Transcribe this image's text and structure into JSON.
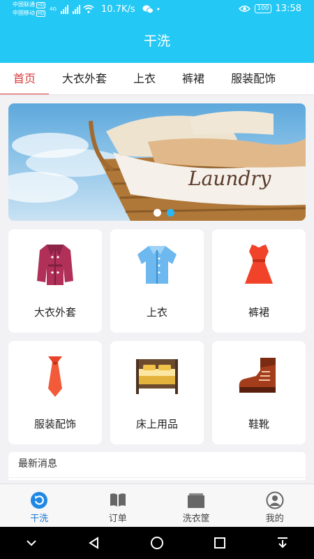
{
  "status_bar": {
    "carrier1": "中国联通",
    "carrier2": "中国移动",
    "hd1": "HD",
    "hd2": "HD",
    "net": "4G",
    "speed": "10.7K/s",
    "battery": "100",
    "time": "13:58"
  },
  "app": {
    "title": "干洗",
    "accent": "#24c8f5",
    "active_tab_color": "#d93a3a"
  },
  "tabs": [
    {
      "label": "首页"
    },
    {
      "label": "大衣外套"
    },
    {
      "label": "上衣"
    },
    {
      "label": "裤裙"
    },
    {
      "label": "服装配饰"
    }
  ],
  "banner": {
    "text": "Laundry",
    "slide_count": 2,
    "active_slide": 2
  },
  "categories": [
    {
      "label": "大衣外套",
      "icon": "coat-icon"
    },
    {
      "label": "上衣",
      "icon": "shirt-icon"
    },
    {
      "label": "裤裙",
      "icon": "dress-icon"
    },
    {
      "label": "服装配饰",
      "icon": "tie-icon"
    },
    {
      "label": "床上用品",
      "icon": "bed-icon"
    },
    {
      "label": "鞋靴",
      "icon": "boot-icon"
    }
  ],
  "news": {
    "title": "最新消息"
  },
  "bottom_nav": [
    {
      "label": "干洗",
      "icon": "refresh-icon",
      "active": true
    },
    {
      "label": "订单",
      "icon": "book-icon",
      "active": false
    },
    {
      "label": "洗衣筐",
      "icon": "basket-icon",
      "active": false
    },
    {
      "label": "我的",
      "icon": "user-icon",
      "active": false
    }
  ]
}
